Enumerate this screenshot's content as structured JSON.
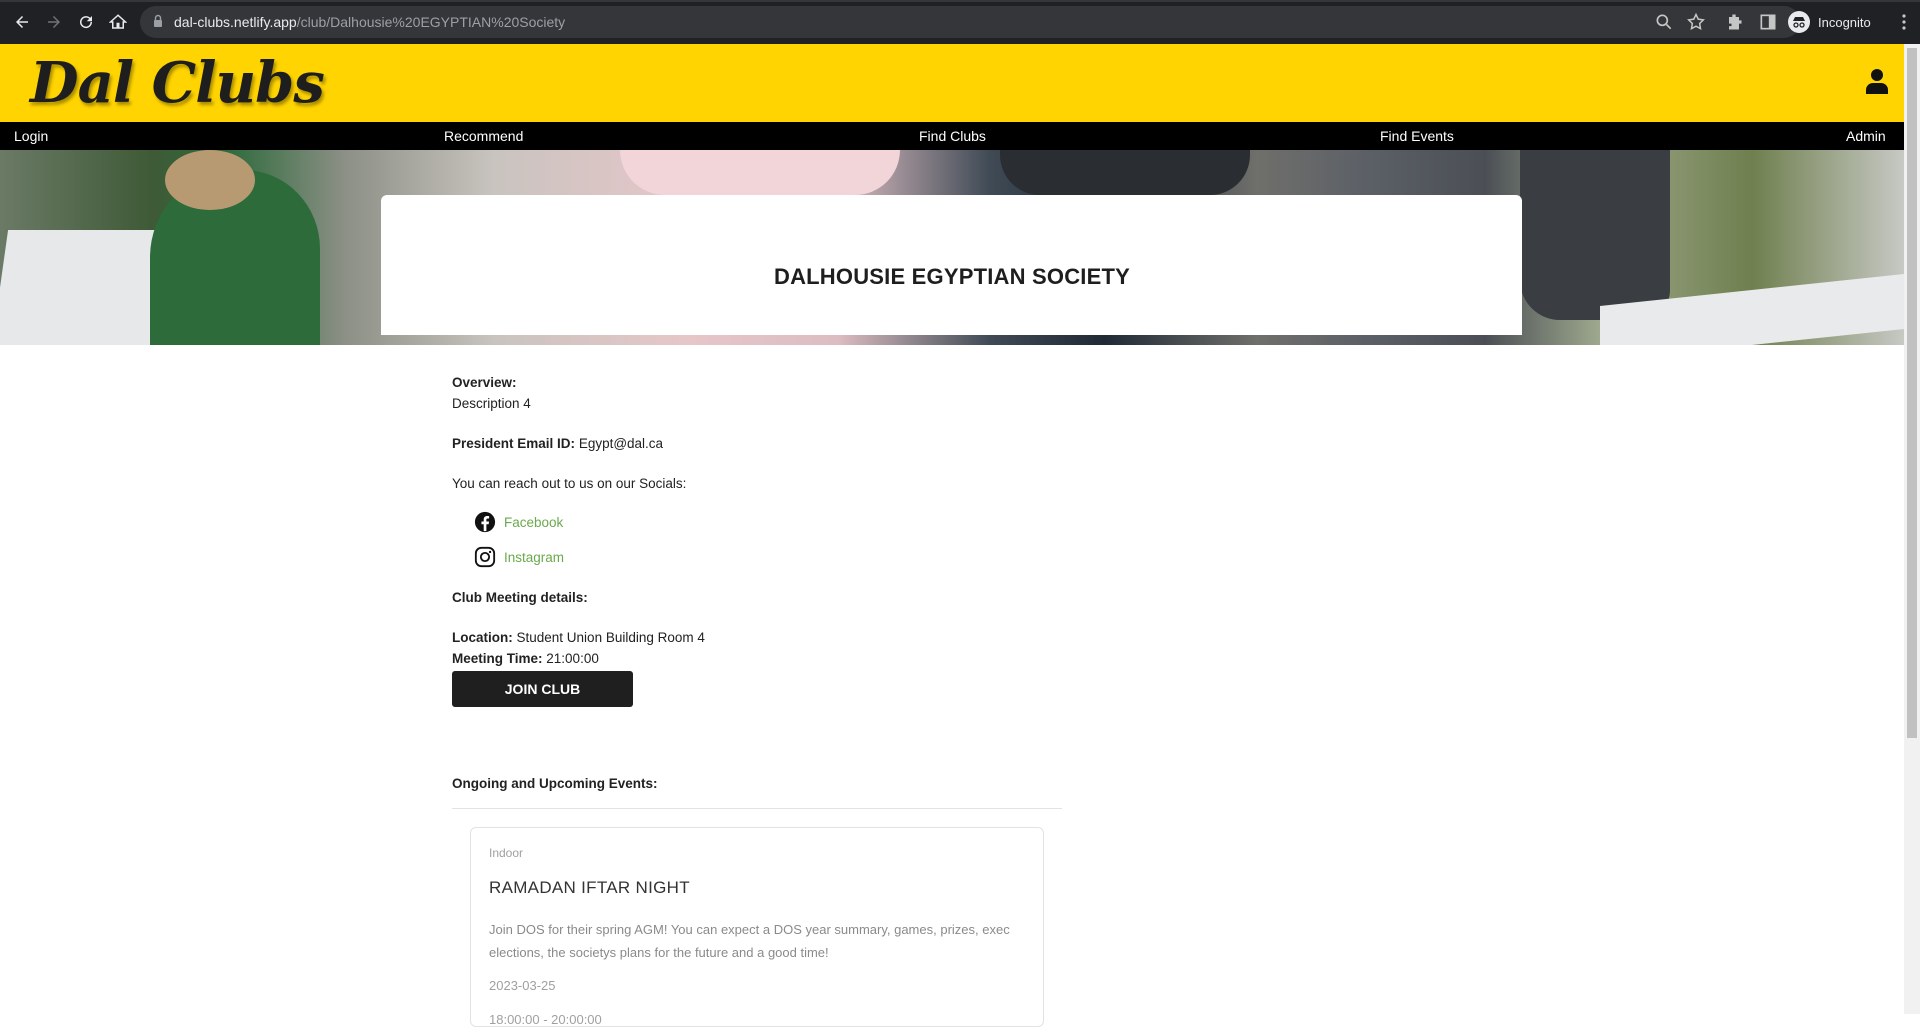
{
  "browser": {
    "url_host": "dal-clubs.netlify.app",
    "url_path": "/club/Dalhousie%20EGYPTIAN%20Society",
    "profile_label": "Incognito"
  },
  "site": {
    "logo": "Dal Clubs",
    "nav": [
      "Login",
      "Recommend",
      "Find Clubs",
      "Find Events",
      "Admin"
    ]
  },
  "club": {
    "title": "DALHOUSIE EGYPTIAN SOCIETY",
    "overview_label": "Overview:",
    "overview_text": "Description 4",
    "email_label": "President Email ID:",
    "email_value": "Egypt@dal.ca",
    "socials_intro": "You can reach out to us on our Socials:",
    "socials": [
      {
        "name": "Facebook",
        "icon": "facebook-icon"
      },
      {
        "name": "Instagram",
        "icon": "instagram-icon"
      }
    ],
    "meeting_label": "Club Meeting details:",
    "location_label": "Location:",
    "location_value": "Student Union Building Room 4",
    "time_label": "Meeting Time:",
    "time_value": "21:00:00",
    "join_button": "JOIN CLUB",
    "events_heading": "Ongoing and Upcoming Events:"
  },
  "events": [
    {
      "tag": "Indoor",
      "title": "RAMADAN IFTAR NIGHT",
      "description": "Join DOS for their spring AGM! You can expect a DOS year summary, games, prizes, exec elections, the societys plans for the future and a good time!",
      "date": "2023-03-25",
      "time": "18:00:00 - 20:00:00"
    }
  ]
}
